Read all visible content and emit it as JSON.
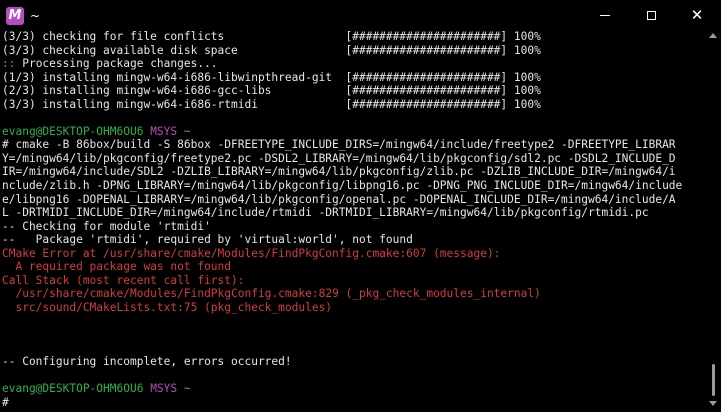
{
  "titlebar": {
    "icon_letter": "M",
    "title": "~",
    "minimize_symbol": "—",
    "maximize_symbol": "☐",
    "close_symbol": "✕"
  },
  "icons": {
    "app": "msys2-icon",
    "minimize": "minimize-icon",
    "maximize": "maximize-icon",
    "close": "close-icon"
  },
  "colors": {
    "background": "#000000",
    "text": "#d3d3d3",
    "cyan": "#3aa8b8",
    "green": "#28b34a",
    "magenta": "#b24fb8",
    "red": "#d23c3c"
  },
  "terminal": {
    "lines": [
      [
        {
          "c": "white",
          "t": "(3/3) checking for file conflicts                  [######################] 100%"
        }
      ],
      [
        {
          "c": "white",
          "t": "(3/3) checking available disk space                [######################] 100%"
        }
      ],
      [
        {
          "c": "cyan",
          "t": ":: "
        },
        {
          "c": "white",
          "t": "Processing package changes..."
        }
      ],
      [
        {
          "c": "white",
          "t": "(1/3) installing mingw-w64-i686-libwinpthread-git  [######################] 100%"
        }
      ],
      [
        {
          "c": "white",
          "t": "(2/3) installing mingw-w64-i686-gcc-libs           [######################] 100%"
        }
      ],
      [
        {
          "c": "white",
          "t": "(3/3) installing mingw-w64-i686-rtmidi             [######################] 100%"
        }
      ],
      [
        {
          "c": "white",
          "t": ""
        }
      ],
      [
        {
          "c": "green",
          "t": "evang@DESKTOP-OHM6OU6 "
        },
        {
          "c": "magenta",
          "t": "MSYS "
        },
        {
          "c": "cyan",
          "t": "~"
        }
      ],
      [
        {
          "c": "white",
          "t": "# cmake -B 86box/build -S 86box -DFREETYPE_INCLUDE_DIRS=/mingw64/include/freetype2 -DFREETYPE_LIBRAR"
        }
      ],
      [
        {
          "c": "white",
          "t": "Y=/mingw64/lib/pkgconfig/freetype2.pc -DSDL2_LIBRARY=/mingw64/lib/pkgconfig/sdl2.pc -DSDL2_INCLUDE_D"
        }
      ],
      [
        {
          "c": "white",
          "t": "IR=/mingw64/include/SDL2 -DZLIB_LIBRARY=/mingw64/lib/pkgconfig/zlib.pc -DZLIB_INCLUDE_DIR=/mingw64/i"
        }
      ],
      [
        {
          "c": "white",
          "t": "nclude/zlib.h -DPNG_LIBRARY=/mingw64/lib/pkgconfig/libpng16.pc -DPNG_PNG_INCLUDE_DIR=/mingw64/include"
        }
      ],
      [
        {
          "c": "white",
          "t": "e/libpng16 -DOPENAL_LIBRARY=/mingw64/lib/pkgconfig/openal.pc -DOPENAL_INCLUDE_DIR=/mingw64/include/A"
        }
      ],
      [
        {
          "c": "white",
          "t": "L -DRTMIDI_INCLUDE_DIR=/mingw64/include/rtmidi -DRTMIDI_LIBRARY=/mingw64/lib/pkgconfig/rtmidi.pc"
        }
      ],
      [
        {
          "c": "white",
          "t": "-- Checking for module 'rtmidi'"
        }
      ],
      [
        {
          "c": "white",
          "t": "--   Package 'rtmidi', required by 'virtual:world', not found"
        }
      ],
      [
        {
          "c": "red",
          "t": "CMake Error at /usr/share/cmake/Modules/FindPkgConfig.cmake:607 (message):"
        }
      ],
      [
        {
          "c": "red",
          "t": "  A required package was not found"
        }
      ],
      [
        {
          "c": "red",
          "t": "Call Stack (most recent call first):"
        }
      ],
      [
        {
          "c": "red",
          "t": "  /usr/share/cmake/Modules/FindPkgConfig.cmake:829 (_pkg_check_modules_internal)"
        }
      ],
      [
        {
          "c": "red",
          "t": "  src/sound/CMakeLists.txt:75 (pkg_check_modules)"
        }
      ],
      [
        {
          "c": "white",
          "t": ""
        }
      ],
      [
        {
          "c": "white",
          "t": ""
        }
      ],
      [
        {
          "c": "white",
          "t": ""
        }
      ],
      [
        {
          "c": "white",
          "t": "-- Configuring incomplete, errors occurred!"
        }
      ],
      [
        {
          "c": "white",
          "t": ""
        }
      ],
      [
        {
          "c": "green",
          "t": "evang@DESKTOP-OHM6OU6 "
        },
        {
          "c": "magenta",
          "t": "MSYS "
        },
        {
          "c": "cyan",
          "t": "~"
        }
      ],
      [
        {
          "c": "white",
          "t": "# "
        }
      ]
    ]
  }
}
